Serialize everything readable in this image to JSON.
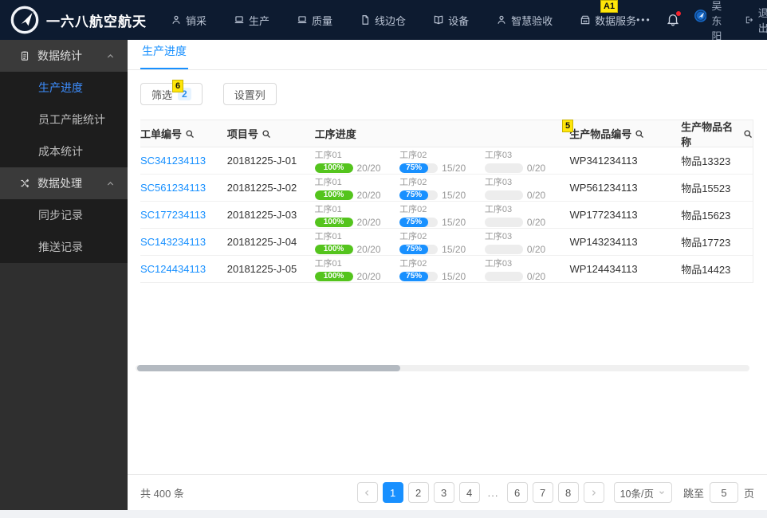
{
  "colors": {
    "accent": "#1890ff",
    "success-green": "#54c41d",
    "navbar-bg": "#0d1b30",
    "annotation-yellow": "#ffe60a"
  },
  "navbar": {
    "brand": "一六八航空航天",
    "items": [
      {
        "label": "销采",
        "icon": "user-icon"
      },
      {
        "label": "生产",
        "icon": "laptop-icon"
      },
      {
        "label": "质量",
        "icon": "laptop-icon"
      },
      {
        "label": "线边仓",
        "icon": "file-icon"
      },
      {
        "label": "设备",
        "icon": "book-icon"
      },
      {
        "label": "智慧验收",
        "icon": "user-icon"
      },
      {
        "label": "数据服务",
        "icon": "building-icon"
      }
    ],
    "more_label": "•••",
    "annotation_a1": "A1",
    "user_name": "吴东阳",
    "logout_label": "退出"
  },
  "sidebar": {
    "groups": [
      {
        "label": "数据统计",
        "icon": "clipboard-icon",
        "items": [
          {
            "label": "生产进度",
            "active": true
          },
          {
            "label": "员工产能统计",
            "active": false
          },
          {
            "label": "成本统计",
            "active": false
          }
        ]
      },
      {
        "label": "数据处理",
        "icon": "shuffle-icon",
        "items": [
          {
            "label": "同步记录",
            "active": false
          },
          {
            "label": "推送记录",
            "active": false
          }
        ]
      }
    ]
  },
  "main": {
    "tab": "生产进度",
    "filter_button": "筛选",
    "filter_badge": "2",
    "annotation_6": "6",
    "annotation_5": "5",
    "columns_button": "设置列",
    "table": {
      "headers": [
        {
          "label": "工单编号",
          "search": true
        },
        {
          "label": "项目号",
          "search": true
        },
        {
          "label": "工序进度",
          "search": false
        },
        {
          "label": "生产物品编号",
          "search": true
        },
        {
          "label": "生产物品名称",
          "search": true
        }
      ],
      "rows": [
        {
          "work_order": "SC341234113",
          "project": "20181225-J-01",
          "item_no": "WP341234113",
          "item_name": "物品13323",
          "processes": [
            {
              "label": "工序01",
              "percent": 100,
              "percent_text": "100%",
              "count": "20/20",
              "color": "green"
            },
            {
              "label": "工序02",
              "percent": 75,
              "percent_text": "75%",
              "count": "15/20",
              "color": "blue"
            },
            {
              "label": "工序03",
              "percent": 0,
              "percent_text": "",
              "count": "0/20",
              "color": "gray"
            }
          ]
        },
        {
          "work_order": "SC561234113",
          "project": "20181225-J-02",
          "item_no": "WP561234113",
          "item_name": "物品15523",
          "processes": [
            {
              "label": "工序01",
              "percent": 100,
              "percent_text": "100%",
              "count": "20/20",
              "color": "green"
            },
            {
              "label": "工序02",
              "percent": 75,
              "percent_text": "75%",
              "count": "15/20",
              "color": "blue"
            },
            {
              "label": "工序03",
              "percent": 0,
              "percent_text": "",
              "count": "0/20",
              "color": "gray"
            }
          ]
        },
        {
          "work_order": "SC177234113",
          "project": "20181225-J-03",
          "item_no": "WP177234113",
          "item_name": "物品15623",
          "processes": [
            {
              "label": "工序01",
              "percent": 100,
              "percent_text": "100%",
              "count": "20/20",
              "color": "green"
            },
            {
              "label": "工序02",
              "percent": 75,
              "percent_text": "75%",
              "count": "15/20",
              "color": "blue"
            },
            {
              "label": "工序03",
              "percent": 0,
              "percent_text": "",
              "count": "0/20",
              "color": "gray"
            }
          ]
        },
        {
          "work_order": "SC143234113",
          "project": "20181225-J-04",
          "item_no": "WP143234113",
          "item_name": "物品17723",
          "processes": [
            {
              "label": "工序01",
              "percent": 100,
              "percent_text": "100%",
              "count": "20/20",
              "color": "green"
            },
            {
              "label": "工序02",
              "percent": 75,
              "percent_text": "75%",
              "count": "15/20",
              "color": "blue"
            },
            {
              "label": "工序03",
              "percent": 0,
              "percent_text": "",
              "count": "0/20",
              "color": "gray"
            }
          ]
        },
        {
          "work_order": "SC124434113",
          "project": "20181225-J-05",
          "item_no": "WP124434113",
          "item_name": "物品14423",
          "processes": [
            {
              "label": "工序01",
              "percent": 100,
              "percent_text": "100%",
              "count": "20/20",
              "color": "green"
            },
            {
              "label": "工序02",
              "percent": 75,
              "percent_text": "75%",
              "count": "15/20",
              "color": "blue"
            },
            {
              "label": "工序03",
              "percent": 0,
              "percent_text": "",
              "count": "0/20",
              "color": "gray"
            }
          ]
        }
      ]
    }
  },
  "footer": {
    "total": "共 400 条",
    "pager": [
      {
        "type": "prev",
        "icon": "chevron-left-icon"
      },
      {
        "type": "page",
        "label": "1",
        "active": true
      },
      {
        "type": "page",
        "label": "2",
        "active": false
      },
      {
        "type": "page",
        "label": "3",
        "active": false
      },
      {
        "type": "page",
        "label": "4",
        "active": false
      },
      {
        "type": "ellipsis",
        "label": "..."
      },
      {
        "type": "page",
        "label": "6",
        "active": false
      },
      {
        "type": "page",
        "label": "7",
        "active": false
      },
      {
        "type": "page",
        "label": "8",
        "active": false
      },
      {
        "type": "next",
        "icon": "chevron-right-icon"
      }
    ],
    "page_size": "10条/页",
    "jump_prefix": "跳至",
    "jump_value": "5",
    "jump_suffix": "页"
  }
}
